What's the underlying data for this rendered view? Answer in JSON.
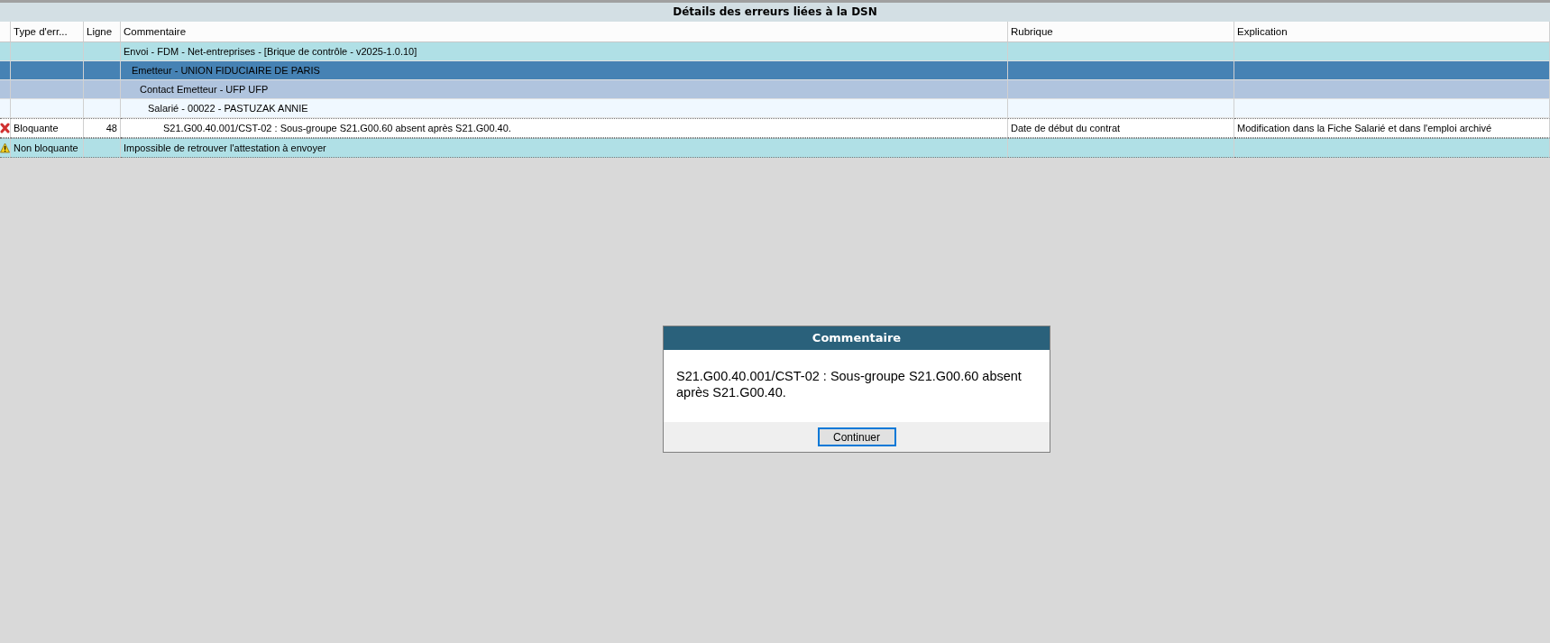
{
  "title": "Détails des erreurs liées à la DSN",
  "table": {
    "columns": [
      "Type d'err...",
      "Ligne",
      "Commentaire",
      "Rubrique",
      "Explication"
    ],
    "rows": [
      {
        "kind": "group",
        "selected": false,
        "comment": "Envoi - FDM - Net-entreprises - [Brique de contrôle - v2025-1.0.10]",
        "children": [
          {
            "kind": "group",
            "selected": true,
            "comment": "Emetteur - UNION FIDUCIAIRE DE PARIS",
            "children": [
              {
                "kind": "group",
                "selected": false,
                "comment": "Contact Emetteur - UFP UFP",
                "children": [
                  {
                    "kind": "group",
                    "selected": false,
                    "comment": "Salarié - 00022 - PASTUZAK ANNIE",
                    "children": [
                      {
                        "kind": "blocking",
                        "selected": false,
                        "type": "Bloquante",
                        "line": "48",
                        "comment": "S21.G00.40.001/CST-02 : Sous-groupe S21.G00.60 absent après S21.G00.40.",
                        "rubrique": "Date de début du contrat",
                        "explication": "Modification dans la Fiche Salarié et dans l'emploi archivé"
                      }
                    ]
                  }
                ]
              }
            ]
          }
        ]
      },
      {
        "kind": "warning",
        "selected": false,
        "type": "Non bloquante",
        "comment": "Impossible de retrouver l'attestation à envoyer"
      }
    ]
  },
  "dialog": {
    "title": "Commentaire",
    "message": "S21.G00.40.001/CST-02 : Sous-groupe S21.G00.60 absent après S21.G00.40.",
    "button": "Continuer"
  }
}
